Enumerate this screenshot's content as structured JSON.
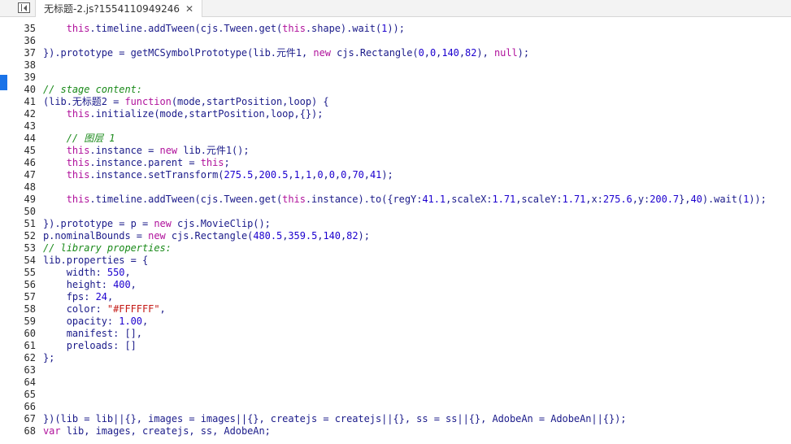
{
  "tab": {
    "title": "无标题-2.js?1554110949246",
    "close_glyph": "✕"
  },
  "editor": {
    "lines": [
      {
        "num": "35",
        "tokens": [
          {
            "t": "    "
          },
          {
            "t": "this",
            "c": "kw"
          },
          {
            "t": ".timeline.addTween(cjs.Tween.get("
          },
          {
            "t": "this",
            "c": "kw"
          },
          {
            "t": ".shape).wait("
          },
          {
            "t": "1",
            "c": "num"
          },
          {
            "t": "));"
          }
        ]
      },
      {
        "num": "36",
        "tokens": []
      },
      {
        "num": "37",
        "tokens": [
          {
            "t": "}).prototype = getMCSymbolPrototype(lib.元件1, "
          },
          {
            "t": "new",
            "c": "kw"
          },
          {
            "t": " cjs.Rectangle("
          },
          {
            "t": "0",
            "c": "num"
          },
          {
            "t": ","
          },
          {
            "t": "0",
            "c": "num"
          },
          {
            "t": ","
          },
          {
            "t": "140",
            "c": "num"
          },
          {
            "t": ","
          },
          {
            "t": "82",
            "c": "num"
          },
          {
            "t": "), "
          },
          {
            "t": "null",
            "c": "kw"
          },
          {
            "t": ");"
          }
        ]
      },
      {
        "num": "38",
        "tokens": []
      },
      {
        "num": "39",
        "tokens": []
      },
      {
        "num": "40",
        "tokens": [
          {
            "t": "// stage content:",
            "c": "cm"
          }
        ]
      },
      {
        "num": "41",
        "tokens": [
          {
            "t": "(lib.无标题2 = "
          },
          {
            "t": "function",
            "c": "kw"
          },
          {
            "t": "(mode,startPosition,loop) {"
          }
        ]
      },
      {
        "num": "42",
        "tokens": [
          {
            "t": "    "
          },
          {
            "t": "this",
            "c": "kw"
          },
          {
            "t": ".initialize(mode,startPosition,loop,{});"
          }
        ]
      },
      {
        "num": "43",
        "tokens": []
      },
      {
        "num": "44",
        "tokens": [
          {
            "t": "    "
          },
          {
            "t": "// 图层 1",
            "c": "cm"
          }
        ]
      },
      {
        "num": "45",
        "tokens": [
          {
            "t": "    "
          },
          {
            "t": "this",
            "c": "kw"
          },
          {
            "t": ".instance = "
          },
          {
            "t": "new",
            "c": "kw"
          },
          {
            "t": " lib.元件1();"
          }
        ]
      },
      {
        "num": "46",
        "tokens": [
          {
            "t": "    "
          },
          {
            "t": "this",
            "c": "kw"
          },
          {
            "t": ".instance.parent = "
          },
          {
            "t": "this",
            "c": "kw"
          },
          {
            "t": ";"
          }
        ]
      },
      {
        "num": "47",
        "tokens": [
          {
            "t": "    "
          },
          {
            "t": "this",
            "c": "kw"
          },
          {
            "t": ".instance.setTransform("
          },
          {
            "t": "275.5",
            "c": "num"
          },
          {
            "t": ","
          },
          {
            "t": "200.5",
            "c": "num"
          },
          {
            "t": ","
          },
          {
            "t": "1",
            "c": "num"
          },
          {
            "t": ","
          },
          {
            "t": "1",
            "c": "num"
          },
          {
            "t": ","
          },
          {
            "t": "0",
            "c": "num"
          },
          {
            "t": ","
          },
          {
            "t": "0",
            "c": "num"
          },
          {
            "t": ","
          },
          {
            "t": "0",
            "c": "num"
          },
          {
            "t": ","
          },
          {
            "t": "70",
            "c": "num"
          },
          {
            "t": ","
          },
          {
            "t": "41",
            "c": "num"
          },
          {
            "t": ");"
          }
        ]
      },
      {
        "num": "48",
        "tokens": []
      },
      {
        "num": "49",
        "tokens": [
          {
            "t": "    "
          },
          {
            "t": "this",
            "c": "kw"
          },
          {
            "t": ".timeline.addTween(cjs.Tween.get("
          },
          {
            "t": "this",
            "c": "kw"
          },
          {
            "t": ".instance).to({regY:"
          },
          {
            "t": "41.1",
            "c": "num"
          },
          {
            "t": ",scaleX:"
          },
          {
            "t": "1.71",
            "c": "num"
          },
          {
            "t": ",scaleY:"
          },
          {
            "t": "1.71",
            "c": "num"
          },
          {
            "t": ",x:"
          },
          {
            "t": "275.6",
            "c": "num"
          },
          {
            "t": ",y:"
          },
          {
            "t": "200.7",
            "c": "num"
          },
          {
            "t": "},"
          },
          {
            "t": "40",
            "c": "num"
          },
          {
            "t": ").wait("
          },
          {
            "t": "1",
            "c": "num"
          },
          {
            "t": "));"
          }
        ]
      },
      {
        "num": "50",
        "tokens": []
      },
      {
        "num": "51",
        "tokens": [
          {
            "t": "}).prototype = p = "
          },
          {
            "t": "new",
            "c": "kw"
          },
          {
            "t": " cjs.MovieClip();"
          }
        ]
      },
      {
        "num": "52",
        "tokens": [
          {
            "t": "p.nominalBounds = "
          },
          {
            "t": "new",
            "c": "kw"
          },
          {
            "t": " cjs.Rectangle("
          },
          {
            "t": "480.5",
            "c": "num"
          },
          {
            "t": ","
          },
          {
            "t": "359.5",
            "c": "num"
          },
          {
            "t": ","
          },
          {
            "t": "140",
            "c": "num"
          },
          {
            "t": ","
          },
          {
            "t": "82",
            "c": "num"
          },
          {
            "t": ");"
          }
        ]
      },
      {
        "num": "53",
        "tokens": [
          {
            "t": "// library properties:",
            "c": "cm"
          }
        ]
      },
      {
        "num": "54",
        "tokens": [
          {
            "t": "lib.properties = {"
          }
        ]
      },
      {
        "num": "55",
        "tokens": [
          {
            "t": "    width: "
          },
          {
            "t": "550",
            "c": "num"
          },
          {
            "t": ","
          }
        ]
      },
      {
        "num": "56",
        "tokens": [
          {
            "t": "    height: "
          },
          {
            "t": "400",
            "c": "num"
          },
          {
            "t": ","
          }
        ]
      },
      {
        "num": "57",
        "tokens": [
          {
            "t": "    fps: "
          },
          {
            "t": "24",
            "c": "num"
          },
          {
            "t": ","
          }
        ]
      },
      {
        "num": "58",
        "tokens": [
          {
            "t": "    color: "
          },
          {
            "t": "\"#FFFFFF\"",
            "c": "str"
          },
          {
            "t": ","
          }
        ]
      },
      {
        "num": "59",
        "tokens": [
          {
            "t": "    opacity: "
          },
          {
            "t": "1.00",
            "c": "num"
          },
          {
            "t": ","
          }
        ]
      },
      {
        "num": "60",
        "tokens": [
          {
            "t": "    manifest: [],"
          }
        ]
      },
      {
        "num": "61",
        "tokens": [
          {
            "t": "    preloads: []"
          }
        ]
      },
      {
        "num": "62",
        "tokens": [
          {
            "t": "};"
          }
        ]
      },
      {
        "num": "63",
        "tokens": []
      },
      {
        "num": "64",
        "tokens": []
      },
      {
        "num": "65",
        "tokens": []
      },
      {
        "num": "66",
        "tokens": []
      },
      {
        "num": "67",
        "tokens": [
          {
            "t": "})(lib = lib||{}, images = images||{}, createjs = createjs||{}, ss = ss||{}, AdobeAn = AdobeAn||{});"
          }
        ]
      },
      {
        "num": "68",
        "tokens": [
          {
            "t": "var",
            "c": "kw"
          },
          {
            "t": " lib, images, createjs, ss, AdobeAn;"
          }
        ]
      }
    ]
  },
  "colors": {
    "keyword": "#b0129c",
    "comment": "#1a8a1a",
    "string": "#c41a16",
    "number": "#1c00cf",
    "identifier": "#1b1b8a",
    "gutter_marker": "#1a73e8"
  },
  "icons": {
    "sidebar_toggle": "sidebar-toggle-icon",
    "close": "close-icon"
  }
}
